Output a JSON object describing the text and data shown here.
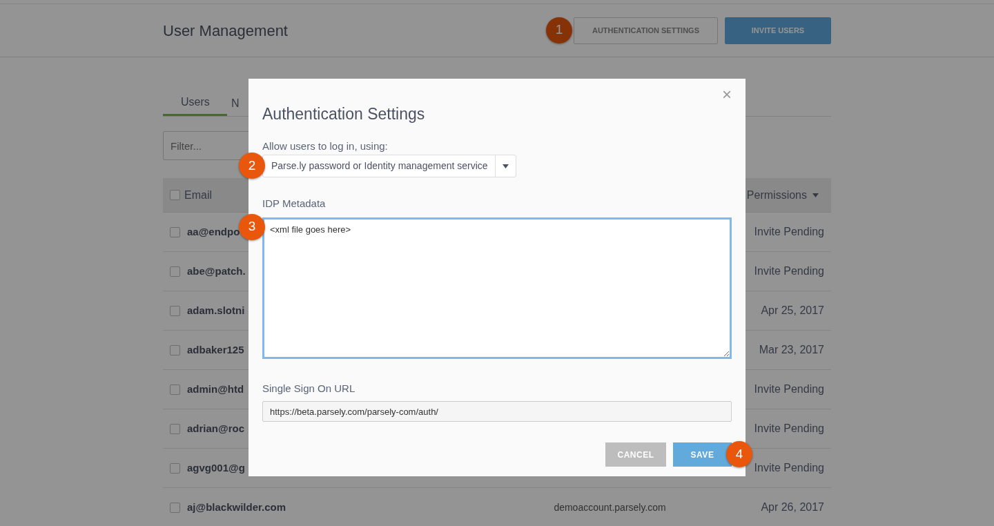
{
  "header": {
    "title": "User Management",
    "buttons": [
      {
        "label": "AUTHENTICATION SETTINGS",
        "kind": "outline",
        "callout": "1"
      },
      {
        "label": "INVITE USERS",
        "kind": "primary"
      }
    ]
  },
  "tabs": [
    {
      "label": "Users",
      "selected": true
    },
    {
      "label": "N",
      "selected": false
    }
  ],
  "filter": {
    "placeholder": "Filter..."
  },
  "table": {
    "header": {
      "checked": false,
      "email": "Email",
      "permissions": "Permissions"
    },
    "rows": [
      {
        "checked": false,
        "email": "aa@endpo",
        "status": "Invite Pending"
      },
      {
        "checked": false,
        "email": "abe@patch.",
        "status": "Invite Pending"
      },
      {
        "checked": false,
        "email": "adam.slotni",
        "status": "Apr 25, 2017"
      },
      {
        "checked": false,
        "email": "adbaker125",
        "status": "Mar 23, 2017"
      },
      {
        "checked": false,
        "email": "admin@htd",
        "status": "Invite Pending"
      },
      {
        "checked": false,
        "email": "adrian@roc",
        "status": "Invite Pending"
      },
      {
        "checked": false,
        "email": "agvg001@g",
        "status": "Invite Pending"
      },
      {
        "checked": false,
        "email": "aj@blackwilder.com",
        "domain": "demoaccount.parsely.com",
        "status": "Apr 26, 2017"
      }
    ]
  },
  "modal": {
    "title": "Authentication Settings",
    "close": "×",
    "login": {
      "label": "Allow users to log in, using:",
      "value": "Parse.ly password or Identity management service",
      "callout": "2"
    },
    "idp": {
      "label": "IDP Metadata",
      "value": "<xml file goes here>",
      "focused": true,
      "callout": "3"
    },
    "sso": {
      "label": "Single Sign On URL",
      "value": "https://beta.parsely.com/parsely-com/auth/"
    },
    "buttons": [
      {
        "label": "CANCEL",
        "kind": "secondary"
      },
      {
        "label": "SAVE",
        "kind": "primary",
        "callout": "4"
      }
    ]
  }
}
